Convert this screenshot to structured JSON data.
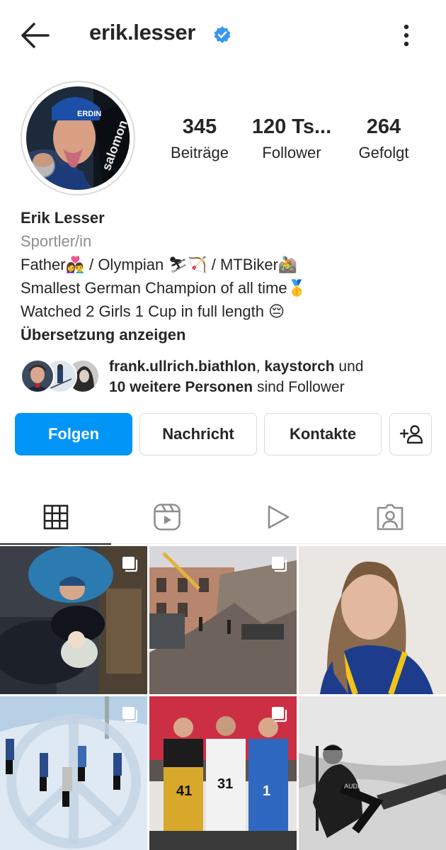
{
  "header": {
    "username": "erik.lesser",
    "verified": true,
    "back_icon": "arrow-left-icon",
    "more_icon": "more-vertical-icon"
  },
  "stats": [
    {
      "value": "345",
      "label": "Beiträge"
    },
    {
      "value": "120 Ts...",
      "label": "Follower"
    },
    {
      "value": "264",
      "label": "Gefolgt"
    }
  ],
  "bio": {
    "name": "Erik Lesser",
    "category": "Sportler/in",
    "lines": [
      "Father👩‍❤️‍👨 / Olympian ⛷🏹 / MTBiker🚵",
      "Smallest German Champion of all time🥇",
      "Watched 2 Girls 1 Cup in full length 😔"
    ],
    "translate": "Übersetzung anzeigen"
  },
  "mutual": {
    "user1": "frank.ullrich.biathlon",
    "sep": ", ",
    "user2": "kaystorch",
    "and": " und",
    "others": "10 weitere Personen",
    "suffix": " sind Follower"
  },
  "actions": {
    "follow": "Folgen",
    "message": "Nachricht",
    "contacts": "Kontakte",
    "suggest_icon": "add-person-icon"
  },
  "tabs": [
    {
      "icon": "grid-icon",
      "active": true
    },
    {
      "icon": "reels-icon",
      "active": false
    },
    {
      "icon": "video-play-icon",
      "active": false
    },
    {
      "icon": "tagged-person-icon",
      "active": false
    }
  ],
  "colors": {
    "accent": "#0095f6",
    "text": "#262626",
    "secondary_text": "#8e8e8e",
    "border": "#dbdbdb"
  },
  "posts": [
    {
      "subject": "sleeping father with baby",
      "multi": true
    },
    {
      "subject": "destroyed building",
      "multi": true
    },
    {
      "subject": "athlete selfie",
      "multi": false
    },
    {
      "subject": "biathlon skiers race",
      "multi": true
    },
    {
      "subject": "olympic podium",
      "multi": true
    },
    {
      "subject": "biathlete black and white",
      "multi": false
    }
  ]
}
